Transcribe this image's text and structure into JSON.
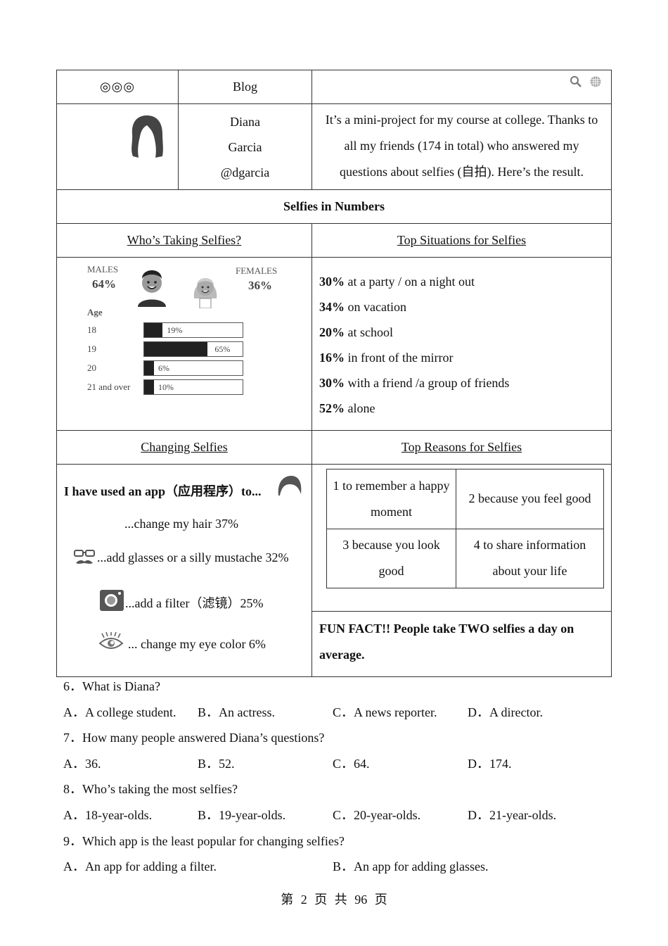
{
  "blog": {
    "header": {
      "dots": "◎◎◎",
      "title": "Blog",
      "icons": [
        "search-icon",
        "globe-icon"
      ]
    },
    "profile": {
      "first_name": "Diana",
      "last_name": "Garcia",
      "handle": "@dgarcia",
      "avatar_icon": "hair-silhouette-icon",
      "intro": "It’s a mini-project for my course at college. Thanks to all my friends (174 in total) who answered my questions about selfies (自拍). Here’s the result."
    },
    "section_title": "Selfies in Numbers",
    "who_heading": "Who’s Taking Selfies?",
    "situations_heading": "Top Situations for Selfies",
    "changing_heading": "Changing Selfies",
    "reasons_heading": "Top Reasons for Selfies",
    "who": {
      "males_label": "MALES",
      "males_pct": "64%",
      "females_label": "FEMALES",
      "females_pct": "36%",
      "age_label": "Age"
    },
    "situations": [
      {
        "pct": "30%",
        "text": " at a party / on a night out"
      },
      {
        "pct": "34%",
        "text": " on vacation"
      },
      {
        "pct": "20%",
        "text": " at school"
      },
      {
        "pct": "16%",
        "text": " in front of the mirror"
      },
      {
        "pct": "30%",
        "text": " with a friend /a group of friends"
      },
      {
        "pct": "52%",
        "text": " alone"
      }
    ],
    "apps": {
      "heading": "I have used an app（应用程序）to...",
      "items": [
        {
          "icon": "hair-icon",
          "text": "...change my hair 37%"
        },
        {
          "icon": "glasses-mustache-icon",
          "text": "...add glasses or a silly mustache 32%"
        },
        {
          "icon": "camera-icon",
          "text": "...add a filter（滤镜）25%"
        },
        {
          "icon": "eye-icon",
          "text": "... change my eye color 6%"
        }
      ]
    },
    "reasons": [
      "1  to remember a happy moment",
      "2  because you feel good",
      "3  because you look good",
      "4  to share information about your life"
    ],
    "fun_fact": "FUN FACT!! People take TWO selfies a day on average."
  },
  "chart_data": {
    "type": "bar",
    "orientation": "horizontal",
    "title": "Age",
    "categories": [
      "18",
      "19",
      "20",
      "21 and over"
    ],
    "values": [
      19,
      65,
      6,
      10
    ],
    "value_labels": [
      "19%",
      "65%",
      "6%",
      "10%"
    ],
    "xlabel": "",
    "ylabel": "Age",
    "xlim": [
      0,
      100
    ],
    "grid": false
  },
  "questions": [
    {
      "number": "6．",
      "text": "What is Diana?",
      "options": [
        "A．A college student.",
        "B．An actress.",
        "C．A news reporter.",
        "D．A director."
      ]
    },
    {
      "number": "7．",
      "text": "How many people answered Diana’s questions?",
      "options": [
        "A．36.",
        "B．52.",
        "C．64.",
        "D．174."
      ]
    },
    {
      "number": "8．",
      "text": "Who’s taking the most selfies?",
      "options": [
        "A．18-year-olds.",
        "B．19-year-olds.",
        "C．20-year-olds.",
        "D．21-year-olds."
      ]
    },
    {
      "number": "9．",
      "text": "Which app is the least popular for changing selfies?",
      "options": [
        "A．An app for adding a filter.",
        "B．An app for adding glasses."
      ]
    }
  ],
  "footer": "第 2 页 共 96 页"
}
